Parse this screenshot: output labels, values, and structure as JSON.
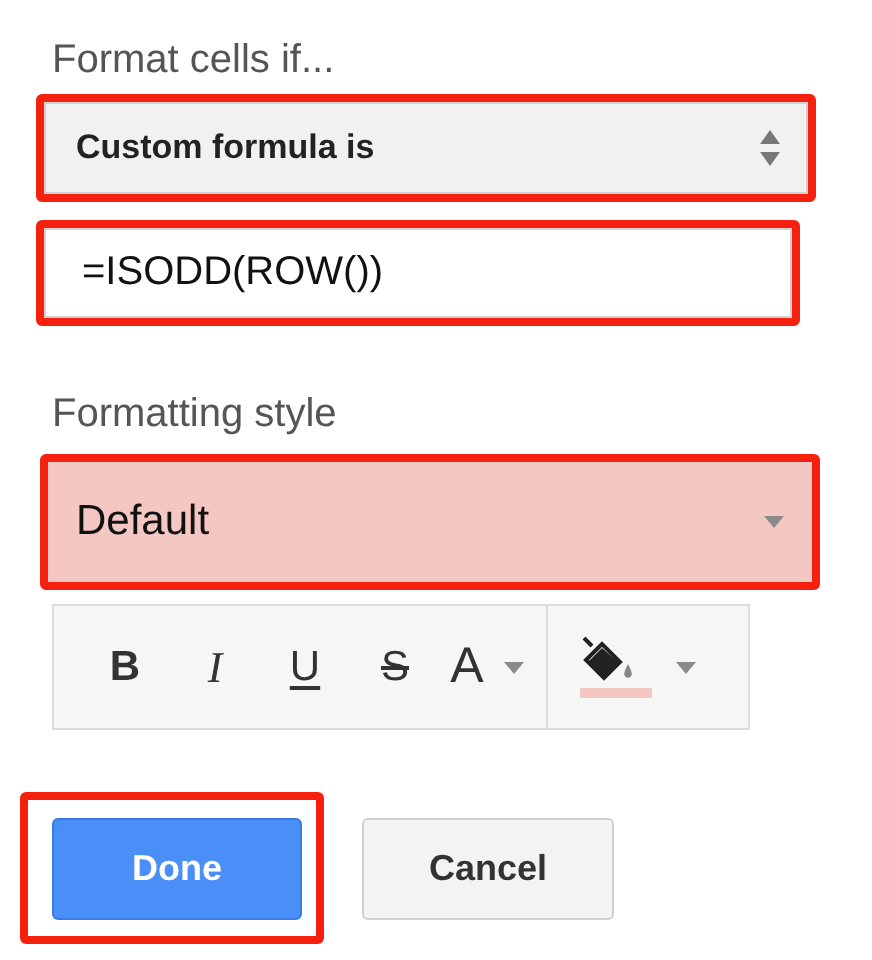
{
  "condition": {
    "label": "Format cells if...",
    "select": {
      "value": "Custom formula is",
      "highlighted": true
    },
    "formula": {
      "value": "=ISODD(ROW())",
      "highlighted": true
    }
  },
  "style": {
    "label": "Formatting style",
    "preset": {
      "value": "Default",
      "highlighted": true
    },
    "toolbar": [
      {
        "kind": "bold",
        "label": "B",
        "menu": false
      },
      {
        "kind": "italic",
        "label": "I",
        "menu": false
      },
      {
        "kind": "underline",
        "label": "U",
        "menu": false
      },
      {
        "kind": "strikethrough",
        "label": "S",
        "menu": false
      },
      {
        "kind": "text-color",
        "label": "A",
        "menu": true
      },
      {
        "kind": "fill-color",
        "menu": true
      }
    ]
  },
  "buttons": [
    {
      "label": "Done",
      "kind": "primary",
      "highlighted": true
    },
    {
      "label": "Cancel",
      "kind": "secondary",
      "highlighted": false
    }
  ]
}
